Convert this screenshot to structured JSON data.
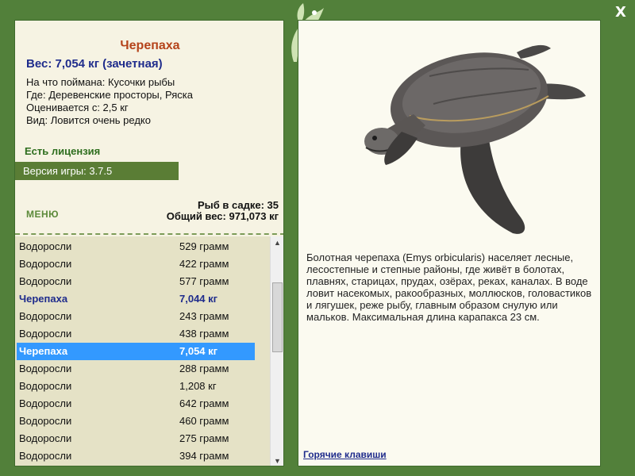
{
  "window": {
    "close_symbol": "X"
  },
  "fish": {
    "title": "Черепаха",
    "weight_line": "Вес: 7,054 кг (зачетная)",
    "caught_on": "На что поймана: Кусочки рыбы",
    "location": "Где: Деревенские просторы, Ряска",
    "valued_from": "Оценивается с: 2,5 кг",
    "rarity": "Вид: Ловится очень редко"
  },
  "license_label": "Есть лицензия",
  "version_label": "Версия игры: 3.7.5",
  "menu_label": "МЕНЮ",
  "keep": {
    "count_line": "Рыб в садке: 35",
    "total_line": "Общий вес: 971,073 кг"
  },
  "catch_list": [
    {
      "name": "Водоросли",
      "weight": "529 грамм",
      "state": "normal"
    },
    {
      "name": "Водоросли",
      "weight": "422 грамм",
      "state": "normal"
    },
    {
      "name": "Водоросли",
      "weight": "577 грамм",
      "state": "normal"
    },
    {
      "name": "Черепаха",
      "weight": "7,044 кг",
      "state": "trophy"
    },
    {
      "name": "Водоросли",
      "weight": "243 грамм",
      "state": "normal"
    },
    {
      "name": "Водоросли",
      "weight": "438 грамм",
      "state": "normal"
    },
    {
      "name": "Черепаха",
      "weight": "7,054 кг",
      "state": "selected"
    },
    {
      "name": "Водоросли",
      "weight": "288 грамм",
      "state": "normal"
    },
    {
      "name": "Водоросли",
      "weight": "1,208 кг",
      "state": "normal"
    },
    {
      "name": "Водоросли",
      "weight": "642 грамм",
      "state": "normal"
    },
    {
      "name": "Водоросли",
      "weight": "460 грамм",
      "state": "normal"
    },
    {
      "name": "Водоросли",
      "weight": "275 грамм",
      "state": "normal"
    },
    {
      "name": "Водоросли",
      "weight": "394 грамм",
      "state": "normal"
    }
  ],
  "scroll": {
    "up_symbol": "▲",
    "down_symbol": "▼"
  },
  "description": "Болотная черепаха (Emys orbicularis) населяет лесные, лесостепные и степные районы, где живёт в болотах, плавнях, старицах, прудах, озёрах, реках, каналах. В воде ловит насекомых, ракообразных, моллюсков, головастиков и лягушек, реже рыбу, главным образом снулую или мальков. Максимальная длина карапакса 23 см.",
  "hotkeys_label": "Горячие клавиши",
  "icons": {
    "close": "close-icon",
    "leaf": "leaf-ornament-icon",
    "turtle": "turtle-illustration"
  },
  "colors": {
    "frame": "#52803a",
    "panel": "#f6f3e3",
    "list_bg": "#e5e2c6",
    "title": "#b5431a",
    "weight": "#1f2c8c",
    "selected_row": "#3399ff"
  }
}
